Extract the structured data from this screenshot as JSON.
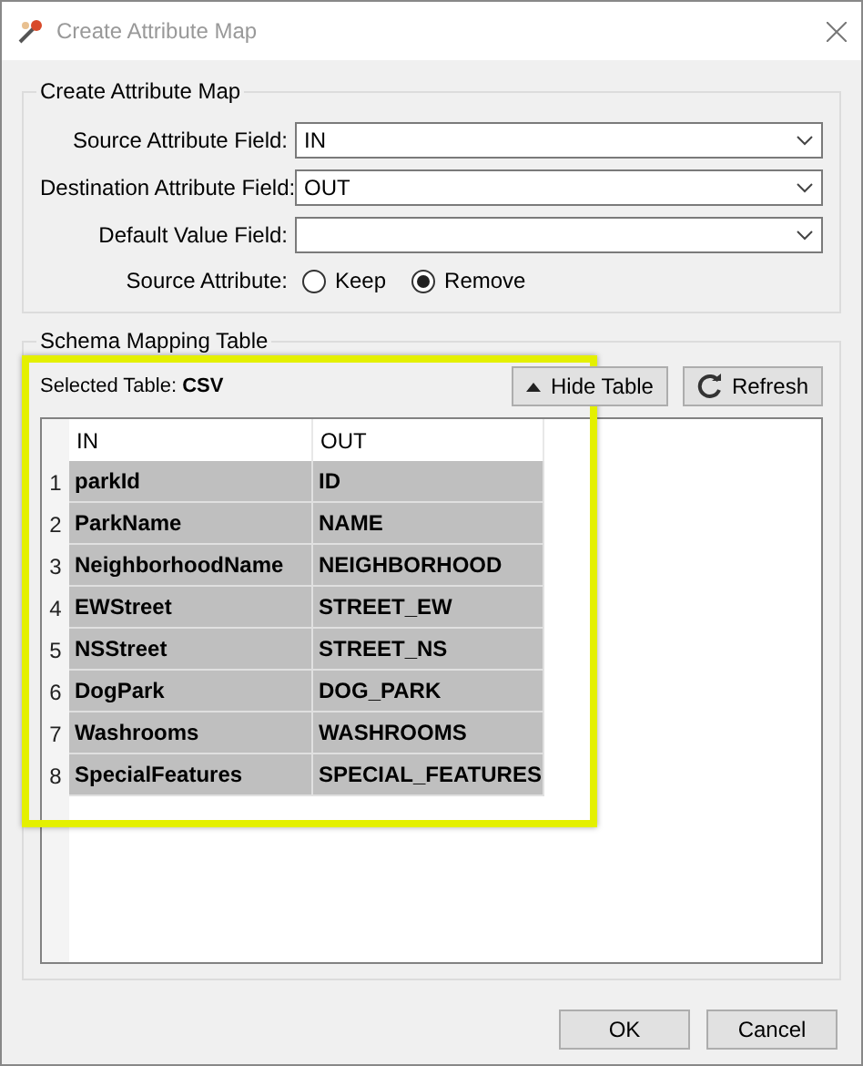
{
  "window": {
    "title": "Create Attribute Map"
  },
  "attribute_map": {
    "title": "Create Attribute Map",
    "fields": [
      {
        "label": "Source Attribute Field:",
        "value": "IN"
      },
      {
        "label": "Destination Attribute Field:",
        "value": "OUT"
      },
      {
        "label": "Default Value Field:"
      }
    ],
    "source_attribute": {
      "label": "Source Attribute:",
      "options": [
        {
          "label": "Keep",
          "selected": false
        },
        {
          "label": "Remove",
          "selected": true
        }
      ]
    }
  },
  "schema_mapping": {
    "title": "Schema Mapping Table",
    "selected_table_label": "Selected Table:",
    "selected_table": "CSV",
    "hide_button": "Hide Table",
    "refresh_button": "Refresh",
    "table": {
      "columns": [
        "IN",
        "OUT"
      ],
      "rows": [
        {
          "number": "1",
          "cells": [
            "parkId",
            "ID"
          ]
        },
        {
          "number": "2",
          "cells": [
            "ParkName",
            "NAME"
          ]
        },
        {
          "number": "3",
          "cells": [
            "NeighborhoodName",
            "NEIGHBORHOOD"
          ]
        },
        {
          "number": "4",
          "cells": [
            "EWStreet",
            "STREET_EW"
          ]
        },
        {
          "number": "5",
          "cells": [
            "NSStreet",
            "STREET_NS"
          ]
        },
        {
          "number": "6",
          "cells": [
            "DogPark",
            "DOG_PARK"
          ]
        },
        {
          "number": "7",
          "cells": [
            "Washrooms",
            "WASHROOMS"
          ]
        },
        {
          "number": "8",
          "cells": [
            "SpecialFeatures",
            "SPECIAL_FEATURES"
          ]
        }
      ]
    }
  },
  "buttons": [
    "OK",
    "Cancel"
  ]
}
